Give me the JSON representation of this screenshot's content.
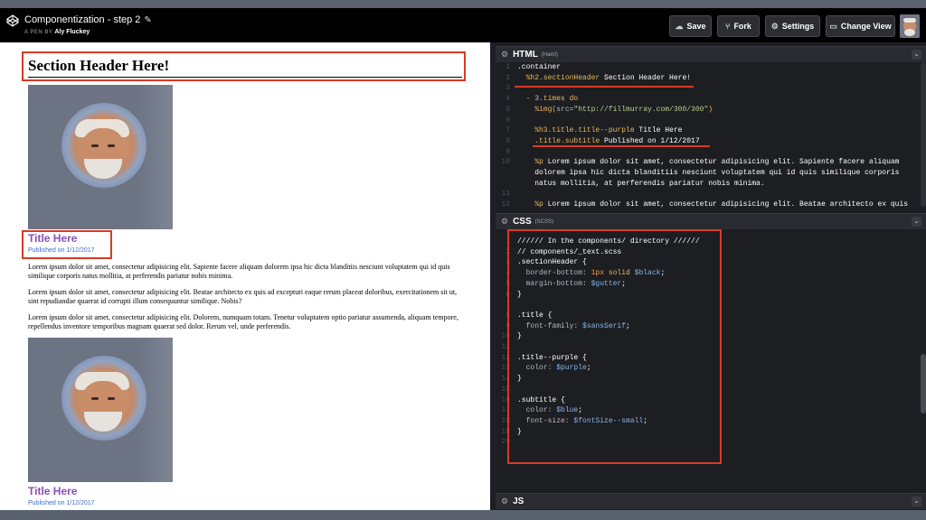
{
  "header": {
    "title": "Componentization - step 2",
    "pencil": "✎",
    "by_label": "A PEN BY",
    "author": "Aly Fluckey",
    "buttons": {
      "save": "Save",
      "fork": "Fork",
      "settings": "Settings",
      "change_view": "Change View"
    }
  },
  "preview": {
    "section_header": "Section Header Here!",
    "items": [
      {
        "title": "Title Here",
        "subtitle": "Published on 1/12/2017",
        "paragraphs": [
          "Lorem ipsum dolor sit amet, consectetur adipisicing elit. Sapiente facere aliquam dolorem ipsa hic dicta blanditiis nesciunt voluptatem qui id quis similique corporis natus mollitia, at perferendis pariatur nobis minima.",
          "Lorem ipsum dolor sit amet, consectetur adipisicing elit. Beatae architecto ex quis ad excepturi eaque rerum placeat doloribus, exercitationem sit ut, sint repudiandae quaerat id corrupti illum consequuntur similique. Nobis?",
          "Lorem ipsum dolor sit amet, consectetur adipisicing elit. Dolorem, numquam totam. Tenetur voluptatem optio pariatur assumenda, aliquam tempore, repellendus inventore temporibus magnam quaerat sed dolor. Rerum vel, unde perferendis."
        ]
      },
      {
        "title": "Title Here",
        "subtitle": "Published on 1/12/2017"
      }
    ]
  },
  "html_panel": {
    "name": "HTML",
    "sub": "(Haml)",
    "line_numbers": [
      "1",
      "2",
      "3",
      "4",
      "5",
      "6",
      "7",
      "8",
      "9",
      "10",
      "",
      "",
      "11",
      "12"
    ],
    "lines": {
      "l1": ".container",
      "l2a": "  %h2",
      "l2b": ".sectionHeader",
      "l2c": " Section Header Here!",
      "l4a": "  - ",
      "l4b": "3",
      "l4c": ".times do",
      "l5a": "    %img(",
      "l5b": "src=",
      "l5c": "\"http://fillmurray.com/300/300\"",
      "l5d": ")",
      "l7a": "    %h3",
      "l7b": ".title.title--purple",
      "l7c": " Title Here",
      "l8a": "    .title.subtitle",
      "l8b": " Published on 1/12/2017",
      "l10a": "    %p",
      "l10b": " Lorem ipsum dolor sit amet, consectetur adipisicing elit. Sapiente facere aliquam",
      "l10c": "    dolorem ipsa hic dicta blanditiis nesciunt voluptatem qui id quis similique corporis",
      "l10d": "    natus mollitia, at perferendis pariatur nobis minima.",
      "l12a": "    %p",
      "l12b": " Lorem ipsum dolor sit amet, consectetur adipisicing elit. Beatae architecto ex quis"
    }
  },
  "css_panel": {
    "name": "CSS",
    "sub": "(SCSS)",
    "line_numbers": [
      "1",
      "2",
      "3",
      "4",
      "5",
      "6",
      "7",
      "8",
      "9",
      "10",
      "11",
      "12",
      "13",
      "14",
      "15",
      "16",
      "17",
      "18",
      "19",
      "20"
    ],
    "lines": {
      "l1": "////// In the components/ directory //////",
      "l2": "// components/_text.scss",
      "l3": ".sectionHeader {",
      "l4a": "  border-bottom: ",
      "l4b": "1px",
      "l4c": " solid ",
      "l4d": "$black",
      "l4e": ";",
      "l5a": "  margin-bottom: ",
      "l5b": "$gutter",
      "l5c": ";",
      "l6": "}",
      "l8": ".title {",
      "l9a": "  font-family: ",
      "l9b": "$sansSerif",
      "l9c": ";",
      "l10": "}",
      "l12": ".title--purple {",
      "l13a": "  color: ",
      "l13b": "$purple",
      "l13c": ";",
      "l14": "}",
      "l16": ".subtitle {",
      "l17a": "  color: ",
      "l17b": "$blue",
      "l17c": ";",
      "l18a": "  font-size: ",
      "l18b": "$fontSize--small",
      "l18c": ";",
      "l19": "}"
    }
  },
  "js_panel": {
    "name": "JS"
  },
  "icons": {
    "logo": "codepen-logo-icon",
    "cloud": "☁",
    "fork": "⑂",
    "gear": "⚙",
    "view": "▭",
    "collapse": "⌄"
  },
  "colors": {
    "annotation_red": "#d93a25",
    "title_purple": "#8b4fb8",
    "subtitle_blue": "#3a6fd0",
    "editor_bg": "#1d1e22"
  }
}
